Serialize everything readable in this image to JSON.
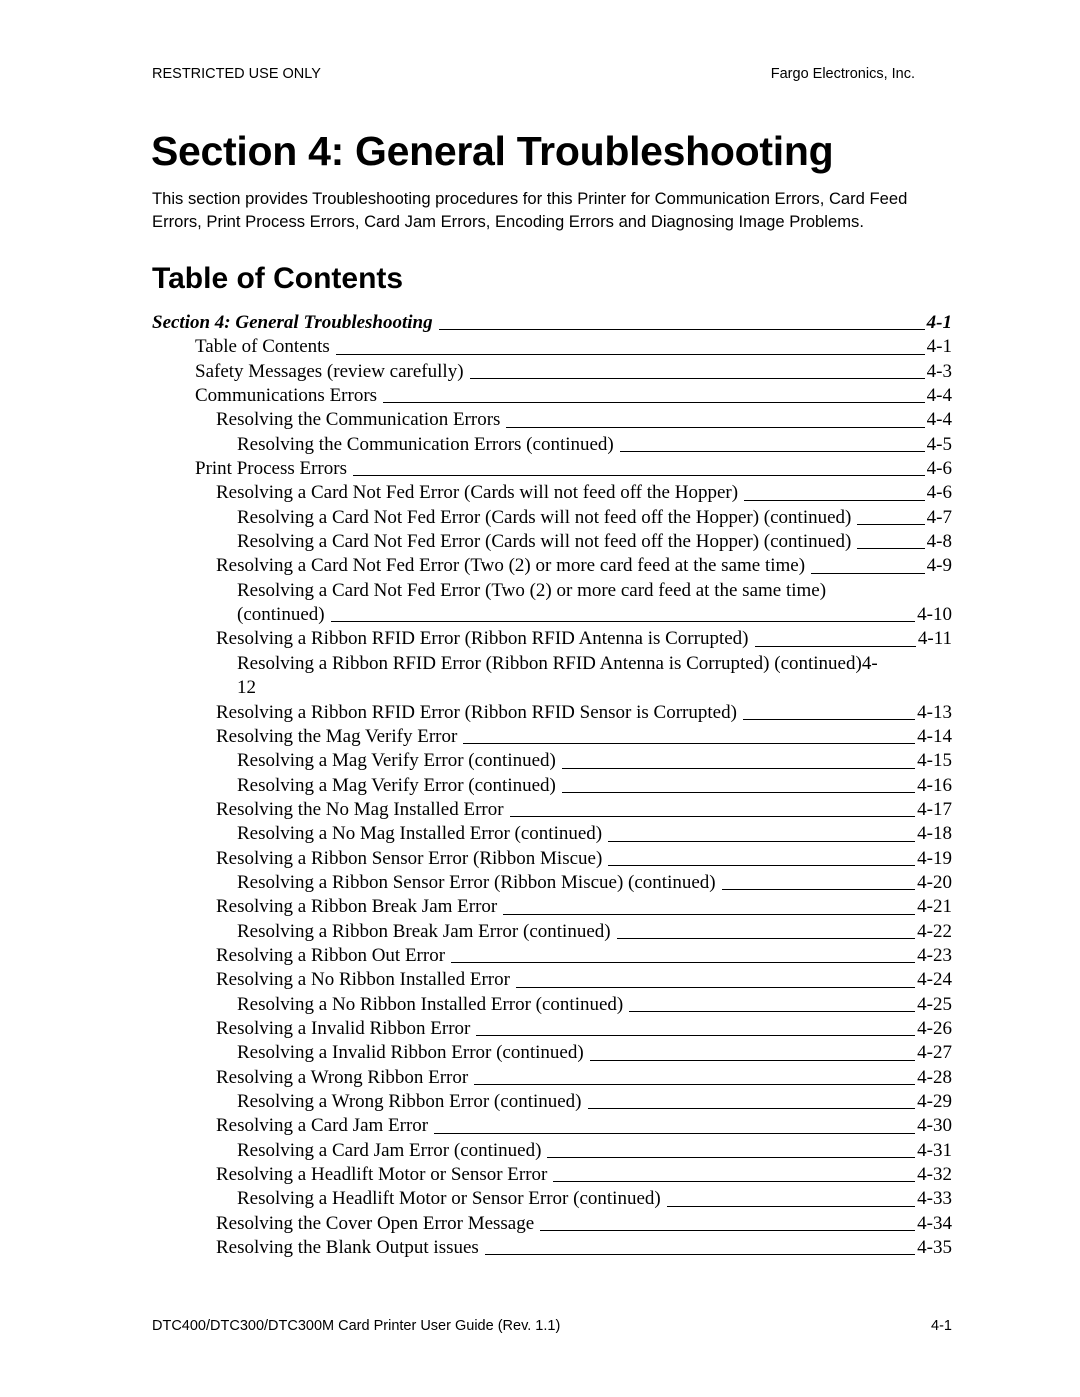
{
  "header": {
    "left": "RESTRICTED USE ONLY",
    "right": "Fargo Electronics, Inc."
  },
  "section_title": "Section 4: General Troubleshooting",
  "intro": "This section provides Troubleshooting procedures for this Printer for Communication Errors, Card Feed Errors, Print Process Errors, Card Jam Errors, Encoding Errors and Diagnosing Image Problems.",
  "toc_title": "Table of Contents",
  "toc": [
    {
      "level": 0,
      "label": "Section 4: General Troubleshooting",
      "page": "4-1"
    },
    {
      "level": 1,
      "label": "Table of Contents",
      "page": "4-1"
    },
    {
      "level": 1,
      "label": "Safety Messages (review carefully)",
      "page": "4-3"
    },
    {
      "level": 1,
      "label": "Communications Errors",
      "page": "4-4"
    },
    {
      "level": 2,
      "label": "Resolving the Communication Errors",
      "page": "4-4"
    },
    {
      "level": 3,
      "label": "Resolving the Communication Errors (continued)",
      "page": "4-5"
    },
    {
      "level": 1,
      "label": "Print Process Errors",
      "page": "4-6"
    },
    {
      "level": 2,
      "label": "Resolving a Card Not Fed Error (Cards will not feed off the Hopper)",
      "page": "4-6"
    },
    {
      "level": 3,
      "label": "Resolving a Card Not Fed Error (Cards will not feed off the Hopper) (continued)",
      "page": "4-7"
    },
    {
      "level": 3,
      "label": "Resolving a Card Not Fed Error (Cards will not feed off the Hopper) (continued)",
      "page": "4-8"
    },
    {
      "level": 2,
      "label": "Resolving a Card Not Fed Error (Two (2) or more card feed at the same time)",
      "page": "4-9"
    },
    {
      "level": 3,
      "label": "Resolving a Card Not Fed Error (Two (2) or more card feed at the same time)",
      "label_cont": "(continued)",
      "page": "4-10"
    },
    {
      "level": 2,
      "label": "Resolving a Ribbon RFID Error (Ribbon RFID Antenna is Corrupted)",
      "page": "4-11"
    },
    {
      "level": 3,
      "label": "Resolving a Ribbon RFID Error (Ribbon RFID Antenna is Corrupted) (continued)4-",
      "label_cont": "12",
      "page": ""
    },
    {
      "level": 2,
      "label": "Resolving a Ribbon RFID Error (Ribbon RFID Sensor is Corrupted)",
      "page": "4-13"
    },
    {
      "level": 2,
      "label": "Resolving the Mag Verify Error",
      "page": "4-14"
    },
    {
      "level": 3,
      "label": "Resolving a Mag Verify Error (continued)",
      "page": "4-15"
    },
    {
      "level": 3,
      "label": "Resolving a Mag Verify Error (continued)",
      "page": "4-16"
    },
    {
      "level": 2,
      "label": "Resolving the No Mag Installed Error",
      "page": "4-17"
    },
    {
      "level": 3,
      "label": "Resolving a No Mag Installed Error (continued)",
      "page": "4-18"
    },
    {
      "level": 2,
      "label": "Resolving a Ribbon Sensor Error (Ribbon Miscue)",
      "page": "4-19"
    },
    {
      "level": 3,
      "label": "Resolving a Ribbon Sensor Error (Ribbon Miscue) (continued)",
      "page": "4-20"
    },
    {
      "level": 2,
      "label": "Resolving a Ribbon Break Jam Error",
      "page": "4-21"
    },
    {
      "level": 3,
      "label": "Resolving a Ribbon Break Jam Error (continued)",
      "page": "4-22"
    },
    {
      "level": 2,
      "label": "Resolving a Ribbon Out Error",
      "page": "4-23"
    },
    {
      "level": 2,
      "label": "Resolving a No Ribbon Installed Error",
      "page": "4-24"
    },
    {
      "level": 3,
      "label": "Resolving a No Ribbon Installed Error (continued)",
      "page": "4-25"
    },
    {
      "level": 2,
      "label": "Resolving a Invalid Ribbon Error",
      "page": "4-26"
    },
    {
      "level": 3,
      "label": "Resolving a Invalid Ribbon Error (continued)",
      "page": "4-27"
    },
    {
      "level": 2,
      "label": "Resolving a Wrong Ribbon Error",
      "page": "4-28"
    },
    {
      "level": 3,
      "label": "Resolving a Wrong Ribbon Error (continued)",
      "page": "4-29"
    },
    {
      "level": 2,
      "label": "Resolving a Card Jam Error",
      "page": "4-30"
    },
    {
      "level": 3,
      "label": "Resolving a Card Jam Error (continued)",
      "page": "4-31"
    },
    {
      "level": 2,
      "label": "Resolving a Headlift Motor or Sensor Error",
      "page": "4-32"
    },
    {
      "level": 3,
      "label": "Resolving a Headlift Motor or Sensor Error (continued)",
      "page": "4-33"
    },
    {
      "level": 2,
      "label": "Resolving the Cover Open Error Message",
      "page": "4-34"
    },
    {
      "level": 2,
      "label": "Resolving the Blank Output issues",
      "page": "4-35"
    }
  ],
  "footer": {
    "left": "DTC400/DTC300/DTC300M Card Printer User Guide (Rev. 1.1)",
    "right": "4-1"
  }
}
